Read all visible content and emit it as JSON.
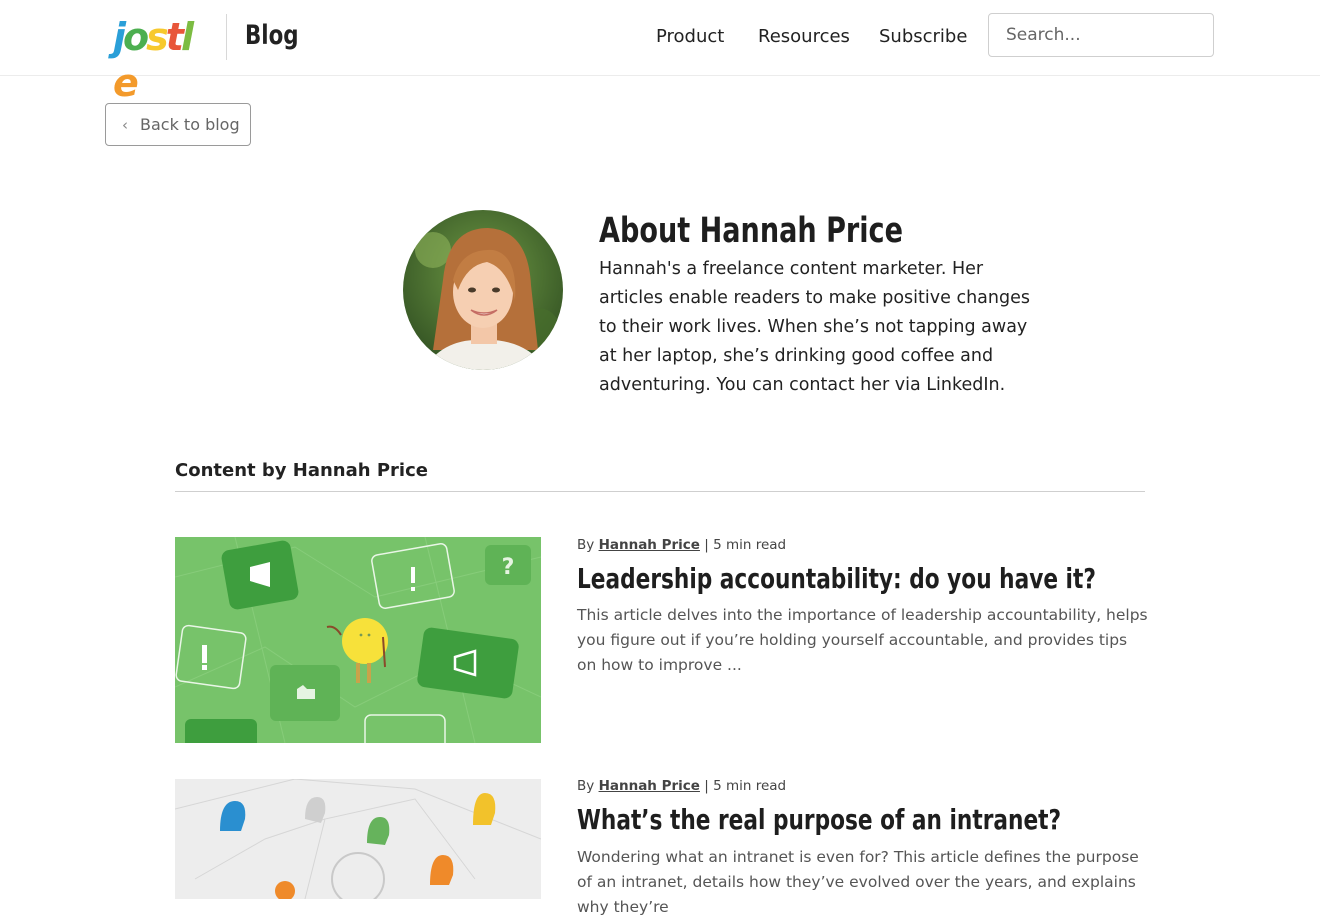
{
  "header": {
    "logo_letters": [
      "j",
      "o",
      "s",
      "t",
      "l",
      "e"
    ],
    "logo_colors": [
      "#2a9fd8",
      "#4caf50",
      "#f7c92d",
      "#e8563a",
      "#7cbc42",
      "#f39a2b"
    ],
    "section_label": "Blog",
    "nav": [
      "Product",
      "Resources",
      "Subscribe"
    ],
    "search_placeholder": "Search..."
  },
  "back_button": {
    "label": "Back to blog",
    "icon": "chevron-left-icon"
  },
  "author": {
    "title": "About Hannah Price",
    "bio": "Hannah's a freelance content marketer. Her articles enable readers to make positive changes to their work lives. When she’s not tapping away at her laptop, she’s drinking good coffee and adventuring. You can contact her via LinkedIn.",
    "avatar": "author-photo"
  },
  "section": {
    "title": "Content by Hannah Price"
  },
  "articles": [
    {
      "by": "By",
      "author": "Hannah Price",
      "read_time": "5 min read",
      "title": "Leadership accountability: do you have it?",
      "excerpt": "This article delves into the importance of leadership accountability, helps you figure out if you’re holding yourself accountable, and provides tips on how to improve ...",
      "image_bg": "#77c36a"
    },
    {
      "by": "By",
      "author": "Hannah Price",
      "read_time": "5 min read",
      "title": "What’s the real purpose of an intranet?",
      "excerpt": "Wondering what an intranet is even for? This article defines the purpose of an intranet, details how they’ve evolved over the years, and explains why they’re",
      "image_bg": "#ededed"
    }
  ],
  "colors": {
    "accent_green": "#3e9e3e",
    "rule": "#cfcfcf"
  }
}
